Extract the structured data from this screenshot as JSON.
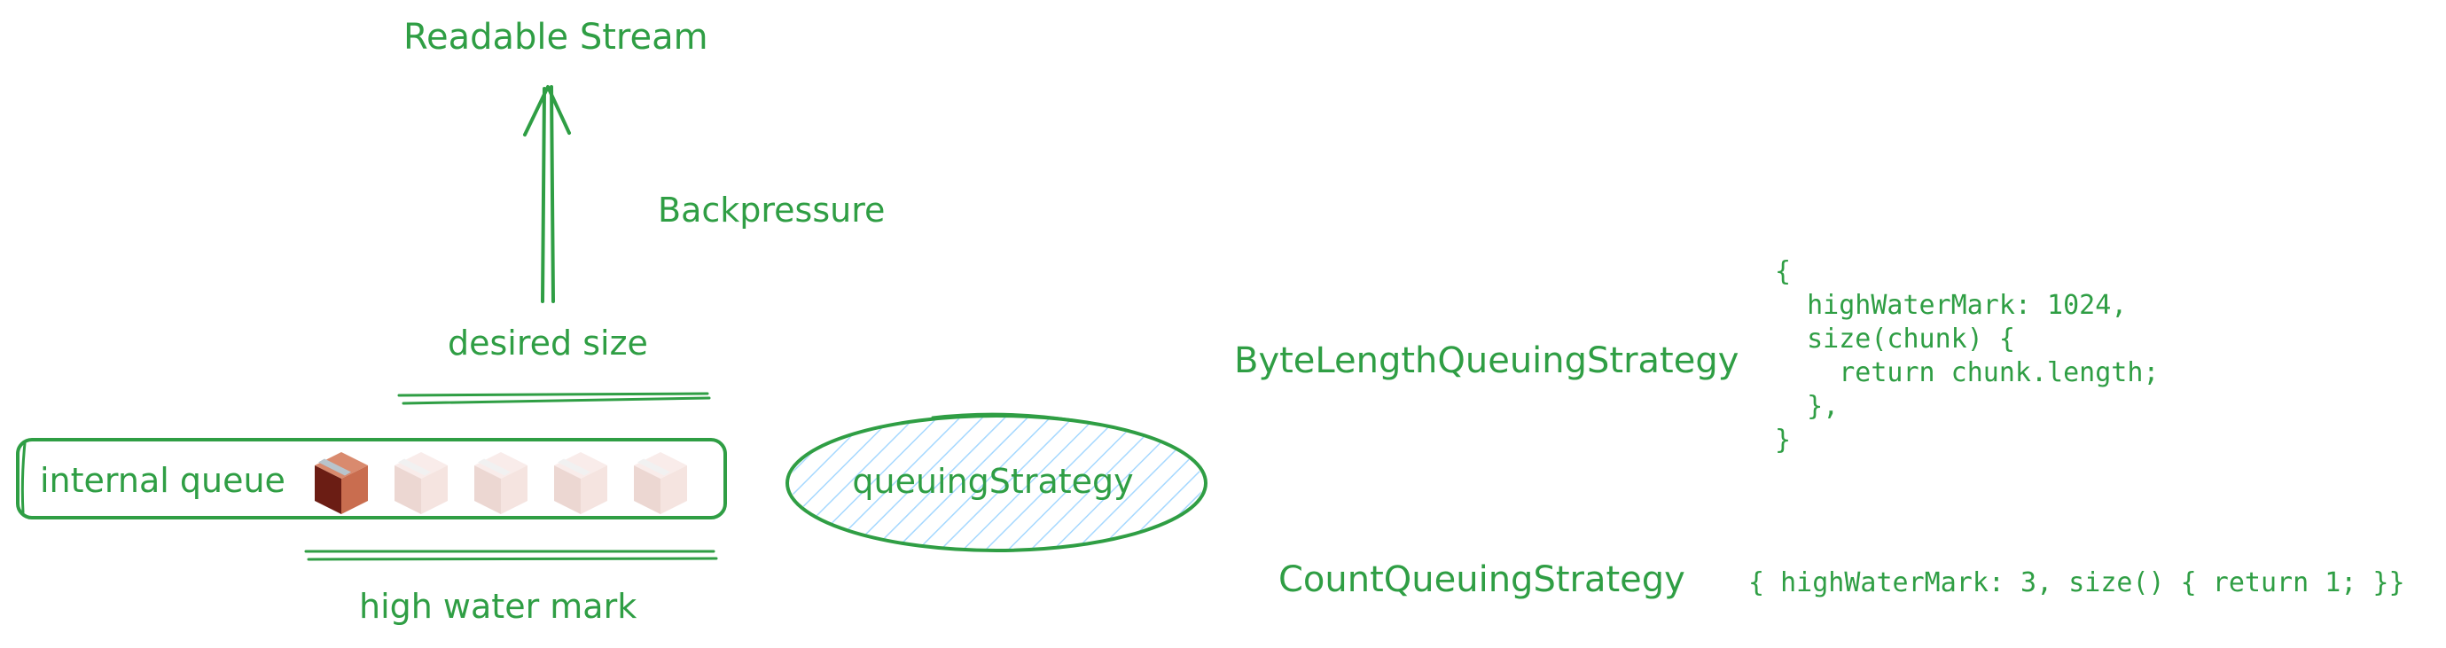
{
  "diagram": {
    "stream_label": "Readable Stream",
    "backpressure_label": "Backpressure",
    "desired_size_label": "desired size",
    "internal_queue_label": "internal queue",
    "high_water_mark_label": "high water mark",
    "queuing_strategy_label": "queuingStrategy",
    "queue_chunks": {
      "filled": 1,
      "total": 5
    }
  },
  "strategies": [
    {
      "name": "ByteLengthQueuingStrategy",
      "code_lines": [
        "{",
        "  highWaterMark: 1024,",
        "  size(chunk) {",
        "    return chunk.length;",
        "  },",
        "}"
      ]
    },
    {
      "name": "CountQueuingStrategy",
      "code_lines": [
        "{ highWaterMark: 3, size() { return 1; }}"
      ]
    }
  ],
  "colors": {
    "ink": "#2f9e44",
    "hatch": "#a5d8ff",
    "box_filled_light": "#c96d4f",
    "box_filled_dark": "#6b1d14",
    "box_tape": "#b8c4cc",
    "box_empty": "#f5e4e0"
  }
}
